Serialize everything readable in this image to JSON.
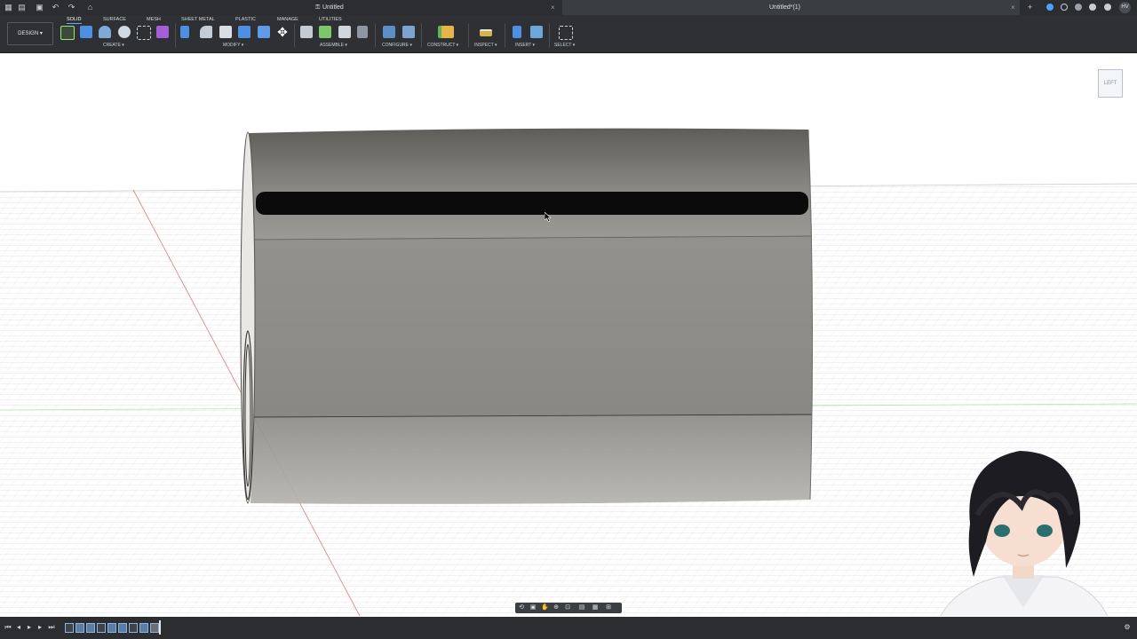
{
  "titlebar": {
    "tabs": [
      {
        "title": "Untitled",
        "close": "×"
      },
      {
        "title": "Untitled*(1)",
        "close": "×"
      }
    ],
    "new_tab": "+",
    "user_initials": "HV"
  },
  "toolbar": {
    "workspace": "DESIGN ▾",
    "tabs": [
      "SOLID",
      "SURFACE",
      "MESH",
      "SHEET METAL",
      "PLASTIC",
      "MANAGE",
      "UTILITIES"
    ],
    "active_tab": "SOLID",
    "groups": [
      "CREATE ▾",
      "MODIFY ▾",
      "ASSEMBLE ▾",
      "CONFIGURE ▾",
      "CONSTRUCT ▾",
      "INSPECT ▾",
      "INSERT ▾",
      "SELECT ▾"
    ]
  },
  "viewcube": {
    "face": "LEFT"
  },
  "colors": {
    "accent": "#6aa8ff",
    "toolbar_bg": "#2e3034",
    "body_fill": "#8c8a84"
  }
}
